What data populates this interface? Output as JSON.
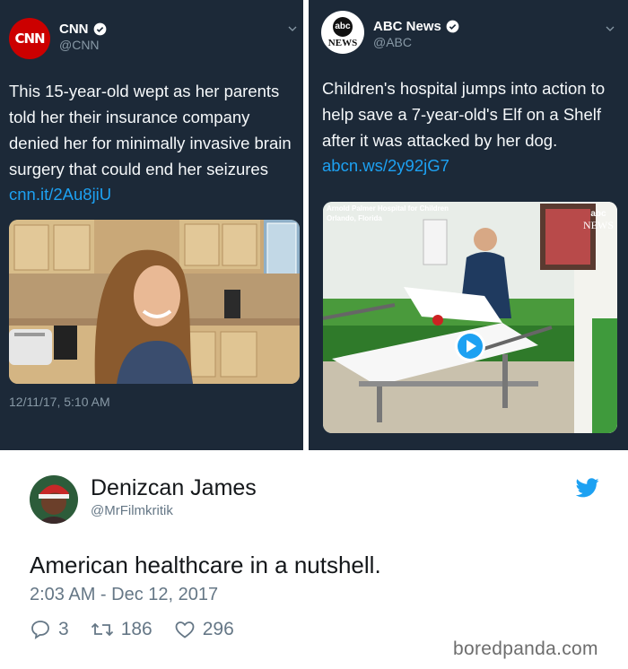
{
  "cnn_tweet": {
    "avatar_text": "CNN",
    "name": "CNN",
    "handle": "@CNN",
    "text_lines": [
      "This 15-year-old wept as her parents",
      "told her their insurance company",
      "denied her for minimally invasive brain",
      "surgery that could end her seizures"
    ],
    "link": "cnn.it/2Au8jiU",
    "timestamp": "12/11/17, 5:10 AM"
  },
  "abc_tweet": {
    "avatar_logo": "abc",
    "avatar_news": "NEWS",
    "name": "ABC News",
    "handle": "@ABC",
    "text_lines": [
      "Children's hospital jumps into action to",
      "help save a 7-year-old's Elf on a Shelf",
      "after it was attacked by her dog."
    ],
    "link": "abcn.ws/2y92jG7",
    "video_caption_1": "Arnold Palmer Hospital for Children",
    "video_caption_2": "Orlando, Florida",
    "video_logo": "abc",
    "video_news": "NEWS"
  },
  "main_tweet": {
    "name": "Denizcan James",
    "handle": "@MrFilmkritik",
    "text": "American healthcare in a nutshell.",
    "date": "2:03 AM - Dec 12, 2017",
    "replies": "3",
    "retweets": "186",
    "likes": "296"
  },
  "watermark": "boredpanda.com",
  "colors": {
    "dark_bg": "#1c2938",
    "link_blue": "#1da1f2",
    "cnn_red": "#cc0000",
    "twitter_blue": "#1da1f2"
  },
  "icons": [
    "verified-icon",
    "chevron-down-icon",
    "play-icon",
    "twitter-bird-icon",
    "reply-icon",
    "retweet-icon",
    "heart-icon"
  ]
}
